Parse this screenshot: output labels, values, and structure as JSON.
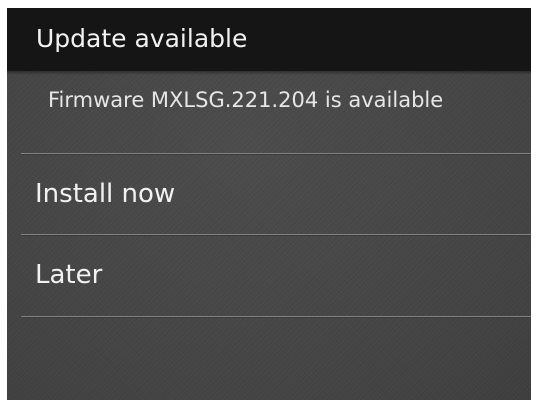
{
  "dialog": {
    "title": "Update available",
    "message": "Firmware MXLSG.221.204 is available",
    "options": [
      {
        "label": "Install now"
      },
      {
        "label": "Later"
      }
    ]
  },
  "colors": {
    "header_background": "#151515",
    "dialog_background": "#474747",
    "text": "#f2f2f2",
    "divider": "#828282"
  }
}
